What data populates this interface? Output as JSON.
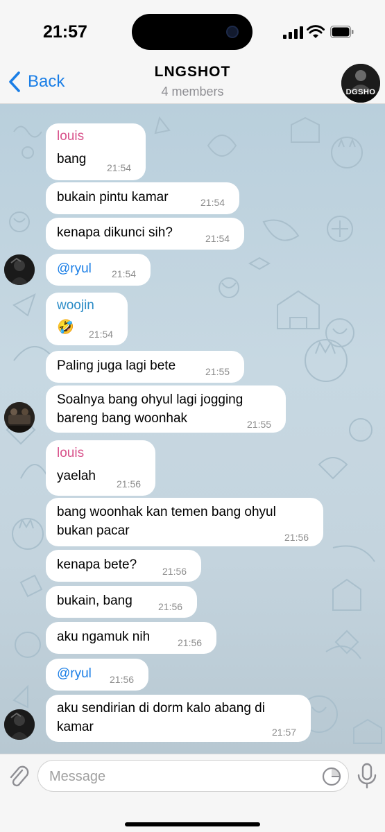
{
  "status": {
    "time": "21:57"
  },
  "header": {
    "back_label": "Back",
    "title": "LNGSHOT",
    "subtitle": "4 members",
    "avatar_text": "DGSHO"
  },
  "messages": [
    {
      "sender": "louis",
      "text": "bang",
      "time": "21:54"
    },
    {
      "text": "bukain pintu kamar",
      "time": "21:54"
    },
    {
      "text": "kenapa dikunci sih?",
      "time": "21:54"
    },
    {
      "text": "@ryul",
      "time": "21:54"
    },
    {
      "sender": "woojin",
      "text": "🤣",
      "time": "21:54"
    },
    {
      "text": "Paling juga lagi bete",
      "time": "21:55"
    },
    {
      "text_line1": "Soalnya bang ohyul lagi jogging",
      "text_line2": "bareng bang woonhak",
      "time": "21:55"
    },
    {
      "sender": "louis",
      "text": "yaelah",
      "time": "21:56"
    },
    {
      "text_line1": "bang woonhak kan temen bang ohyul",
      "text_line2": "bukan pacar",
      "time": "21:56"
    },
    {
      "text": "kenapa bete?",
      "time": "21:56"
    },
    {
      "text": "bukain, bang",
      "time": "21:56"
    },
    {
      "text": "aku ngamuk nih",
      "time": "21:56"
    },
    {
      "text": "@ryul",
      "time": "21:56"
    },
    {
      "text_line1": "aku sendirian di dorm kalo abang di",
      "text_line2": "kamar",
      "time": "21:57"
    }
  ],
  "input": {
    "placeholder": "Message"
  },
  "colors": {
    "accent": "#1a7ee6",
    "louis": "#d8518a",
    "woojin": "#2a8bc6"
  }
}
